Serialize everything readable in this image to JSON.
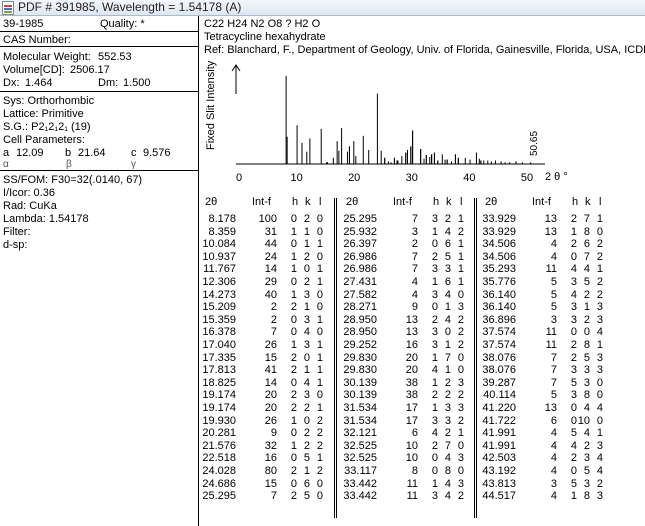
{
  "window": {
    "title": "PDF # 391985,  Wavelength = 1.54178   (A)"
  },
  "card": {
    "pdf_number": "39-1985",
    "quality_label": "Quality: *",
    "cas_label": "CAS Number:",
    "mol_weight_label": "Molecular Weight:",
    "mol_weight_value": "552.53",
    "volume_label": "Volume[CD]:",
    "volume_value": "2506.17",
    "dx_label": "Dx:",
    "dx_value": "1.464",
    "dm_label": "Dm:",
    "dm_value": "1.500",
    "sys": "Sys: Orthorhombic",
    "lattice": "Lattice: Primitive",
    "sg": "S.G.: P2₁2₁2₁ (19)",
    "cell_params_label": "Cell Parameters:",
    "a_label": "a",
    "a_value": "12.09",
    "b_label": "b",
    "b_value": "21.64",
    "c_label": "c",
    "c_value": "9.576",
    "alpha": "α",
    "beta": "β",
    "gamma": "γ",
    "ssfom": "SS/FOM: F30=32(.0140, 67)",
    "icor": "I/Icor: 0.36",
    "rad": "Rad: CuKa",
    "lambda": "Lambda: 1.54178",
    "filter": "Filter:",
    "dsp": "d-sp:"
  },
  "compound": {
    "formula": "C22 H24 N2 O8 ? H2 O",
    "name": "Tetracycline hexahydrate",
    "ref": "Ref: Blanchard, F., Department of Geology, Univ. of Florida, Gainesville, Florida, USA, ICDD G"
  },
  "chart_data": {
    "type": "bar",
    "ylabel": "Fixed  Slit  Intensity",
    "xlabel": "2 θ °",
    "xlim": [
      0,
      50
    ],
    "ticks": [
      "0",
      "10",
      "20",
      "30",
      "40",
      "50"
    ],
    "max_label": "50.65",
    "peaks": [
      [
        8.178,
        100
      ],
      [
        8.359,
        31
      ],
      [
        10.084,
        44
      ],
      [
        10.937,
        24
      ],
      [
        11.767,
        14
      ],
      [
        12.306,
        29
      ],
      [
        14.273,
        40
      ],
      [
        15.209,
        2
      ],
      [
        15.359,
        2
      ],
      [
        16.378,
        7
      ],
      [
        17.04,
        26
      ],
      [
        17.335,
        15
      ],
      [
        17.813,
        41
      ],
      [
        18.825,
        14
      ],
      [
        19.174,
        20
      ],
      [
        19.174,
        20
      ],
      [
        19.93,
        26
      ],
      [
        20.281,
        9
      ],
      [
        21.576,
        32
      ],
      [
        22.518,
        16
      ],
      [
        24.028,
        80
      ],
      [
        24.686,
        15
      ],
      [
        25.295,
        7
      ],
      [
        25.295,
        7
      ],
      [
        25.932,
        3
      ],
      [
        26.397,
        2
      ],
      [
        26.986,
        7
      ],
      [
        26.986,
        7
      ],
      [
        27.431,
        4
      ],
      [
        27.582,
        4
      ],
      [
        28.271,
        9
      ],
      [
        28.95,
        13
      ],
      [
        28.95,
        13
      ],
      [
        29.252,
        16
      ],
      [
        29.83,
        20
      ],
      [
        29.83,
        20
      ],
      [
        30.139,
        38
      ],
      [
        30.139,
        38
      ],
      [
        31.534,
        17
      ],
      [
        31.534,
        17
      ],
      [
        32.121,
        6
      ],
      [
        32.525,
        10
      ],
      [
        32.525,
        10
      ],
      [
        33.117,
        8
      ],
      [
        33.442,
        11
      ],
      [
        33.442,
        11
      ],
      [
        33.929,
        13
      ],
      [
        33.929,
        13
      ],
      [
        34.506,
        4
      ],
      [
        34.506,
        4
      ],
      [
        35.293,
        11
      ],
      [
        35.776,
        5
      ],
      [
        36.14,
        5
      ],
      [
        36.14,
        5
      ],
      [
        36.896,
        3
      ],
      [
        37.574,
        11
      ],
      [
        37.574,
        11
      ],
      [
        38.076,
        7
      ],
      [
        38.076,
        7
      ],
      [
        39.287,
        7
      ],
      [
        40.114,
        5
      ],
      [
        41.22,
        13
      ],
      [
        41.722,
        6
      ],
      [
        41.991,
        4
      ],
      [
        41.991,
        4
      ],
      [
        42.503,
        4
      ],
      [
        43.192,
        4
      ],
      [
        43.813,
        3
      ],
      [
        44.517,
        4
      ],
      [
        45.5,
        3
      ],
      [
        46.2,
        2
      ],
      [
        47.0,
        2
      ],
      [
        48.1,
        3
      ],
      [
        49.2,
        2
      ],
      [
        50.65,
        2
      ]
    ]
  },
  "peaks_table": {
    "headers": {
      "two_theta": "2θ",
      "intf": "Int-f",
      "h": "h",
      "k": "k",
      "l": "l"
    },
    "col1": [
      [
        "8.178",
        "100",
        "0",
        "2",
        "0"
      ],
      [
        "8.359",
        "31",
        "1",
        "1",
        "0"
      ],
      [
        "10.084",
        "44",
        "0",
        "1",
        "1"
      ],
      [
        "10.937",
        "24",
        "1",
        "2",
        "0"
      ],
      [
        "11.767",
        "14",
        "1",
        "0",
        "1"
      ],
      [
        "12.306",
        "29",
        "0",
        "2",
        "1"
      ],
      [
        "14.273",
        "40",
        "1",
        "3",
        "0"
      ],
      [
        "15.209",
        "2",
        "2",
        "1",
        "0"
      ],
      [
        "15.359",
        "2",
        "0",
        "3",
        "1"
      ],
      [
        "16.378",
        "7",
        "0",
        "4",
        "0"
      ],
      [
        "17.040",
        "26",
        "1",
        "3",
        "1"
      ],
      [
        "17.335",
        "15",
        "2",
        "0",
        "1"
      ],
      [
        "17.813",
        "41",
        "2",
        "1",
        "1"
      ],
      [
        "18.825",
        "14",
        "0",
        "4",
        "1"
      ],
      [
        "19.174",
        "20",
        "2",
        "3",
        "0"
      ],
      [
        "19.174",
        "20",
        "2",
        "2",
        "1"
      ],
      [
        "19.930",
        "26",
        "1",
        "0",
        "2"
      ],
      [
        "20.281",
        "9",
        "0",
        "2",
        "2"
      ],
      [
        "21.576",
        "32",
        "1",
        "2",
        "2"
      ],
      [
        "22.518",
        "16",
        "0",
        "5",
        "1"
      ],
      [
        "24.028",
        "80",
        "2",
        "1",
        "2"
      ],
      [
        "24.686",
        "15",
        "0",
        "6",
        "0"
      ],
      [
        "25.295",
        "7",
        "2",
        "5",
        "0"
      ]
    ],
    "col2": [
      [
        "25.295",
        "7",
        "3",
        "2",
        "1"
      ],
      [
        "25.932",
        "3",
        "1",
        "4",
        "2"
      ],
      [
        "26.397",
        "2",
        "0",
        "6",
        "1"
      ],
      [
        "26.986",
        "7",
        "2",
        "5",
        "1"
      ],
      [
        "26.986",
        "7",
        "3",
        "3",
        "1"
      ],
      [
        "27.431",
        "4",
        "1",
        "6",
        "1"
      ],
      [
        "27.582",
        "4",
        "3",
        "4",
        "0"
      ],
      [
        "28.271",
        "9",
        "0",
        "1",
        "3"
      ],
      [
        "28.950",
        "13",
        "2",
        "4",
        "2"
      ],
      [
        "28.950",
        "13",
        "3",
        "0",
        "2"
      ],
      [
        "29.252",
        "16",
        "3",
        "1",
        "2"
      ],
      [
        "29.830",
        "20",
        "1",
        "7",
        "0"
      ],
      [
        "29.830",
        "20",
        "4",
        "1",
        "0"
      ],
      [
        "30.139",
        "38",
        "1",
        "2",
        "3"
      ],
      [
        "30.139",
        "38",
        "2",
        "2",
        "2"
      ],
      [
        "31.534",
        "17",
        "1",
        "3",
        "3"
      ],
      [
        "31.534",
        "17",
        "3",
        "3",
        "2"
      ],
      [
        "32.121",
        "6",
        "4",
        "2",
        "1"
      ],
      [
        "32.525",
        "10",
        "2",
        "7",
        "0"
      ],
      [
        "32.525",
        "10",
        "0",
        "4",
        "3"
      ],
      [
        "33.117",
        "8",
        "0",
        "8",
        "0"
      ],
      [
        "33.442",
        "11",
        "1",
        "4",
        "3"
      ],
      [
        "33.442",
        "11",
        "3",
        "4",
        "2"
      ]
    ],
    "col3": [
      [
        "33.929",
        "13",
        "2",
        "7",
        "1"
      ],
      [
        "33.929",
        "13",
        "1",
        "8",
        "0"
      ],
      [
        "34.506",
        "4",
        "2",
        "6",
        "2"
      ],
      [
        "34.506",
        "4",
        "0",
        "7",
        "2"
      ],
      [
        "35.293",
        "11",
        "4",
        "4",
        "1"
      ],
      [
        "35.776",
        "5",
        "3",
        "5",
        "2"
      ],
      [
        "36.140",
        "5",
        "4",
        "2",
        "2"
      ],
      [
        "36.140",
        "5",
        "3",
        "1",
        "3"
      ],
      [
        "36.896",
        "3",
        "3",
        "2",
        "3"
      ],
      [
        "37.574",
        "11",
        "0",
        "0",
        "4"
      ],
      [
        "37.574",
        "11",
        "2",
        "8",
        "1"
      ],
      [
        "38.076",
        "7",
        "2",
        "5",
        "3"
      ],
      [
        "38.076",
        "7",
        "3",
        "3",
        "3"
      ],
      [
        "39.287",
        "7",
        "5",
        "3",
        "0"
      ],
      [
        "40.114",
        "5",
        "3",
        "8",
        "0"
      ],
      [
        "41.220",
        "13",
        "0",
        "4",
        "4"
      ],
      [
        "41.722",
        "6",
        "0",
        "10",
        "0"
      ],
      [
        "41.991",
        "4",
        "5",
        "4",
        "1"
      ],
      [
        "41.991",
        "4",
        "4",
        "2",
        "3"
      ],
      [
        "42.503",
        "4",
        "2",
        "3",
        "4"
      ],
      [
        "43.192",
        "4",
        "0",
        "5",
        "4"
      ],
      [
        "43.813",
        "3",
        "5",
        "3",
        "2"
      ],
      [
        "44.517",
        "4",
        "1",
        "8",
        "3"
      ]
    ]
  }
}
